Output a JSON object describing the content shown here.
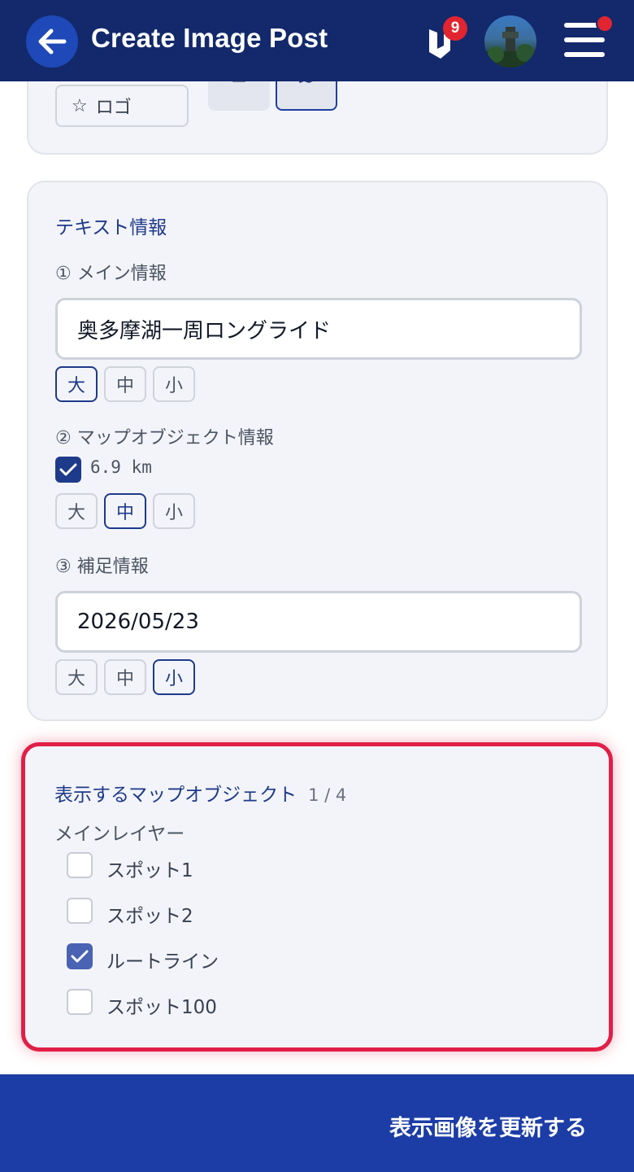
{
  "header": {
    "title": "Create Image Post",
    "notification_count": "9",
    "colors": {
      "bar": "#13296c",
      "badge": "#e02430"
    }
  },
  "top_card": {
    "logo_label": "ロゴ"
  },
  "text_info": {
    "section_title": "テキスト情報",
    "main": {
      "label": "① メイン情報",
      "value": "奥多摩湖一周ロングライド",
      "sizes": [
        "大",
        "中",
        "小"
      ],
      "selected_size": "大"
    },
    "map_object": {
      "label": "② マップオブジェクト情報",
      "checked": true,
      "value": "6.9 km",
      "sizes": [
        "大",
        "中",
        "小"
      ],
      "selected_size": "中"
    },
    "supplement": {
      "label": "③ 補足情報",
      "value": "2026/05/23",
      "sizes": [
        "大",
        "中",
        "小"
      ],
      "selected_size": "小"
    }
  },
  "map_objects": {
    "title": "表示するマップオブジェクト",
    "count": "1 / 4",
    "layer_label": "メインレイヤー",
    "items": [
      {
        "label": "スポット1",
        "checked": false
      },
      {
        "label": "スポット2",
        "checked": false
      },
      {
        "label": "ルートライン",
        "checked": true
      },
      {
        "label": "スポット100",
        "checked": false
      }
    ],
    "highlight_color": "#e01f47"
  },
  "footer": {
    "update_label": "表示画像を更新する",
    "bar_color": "#1c3da6"
  }
}
